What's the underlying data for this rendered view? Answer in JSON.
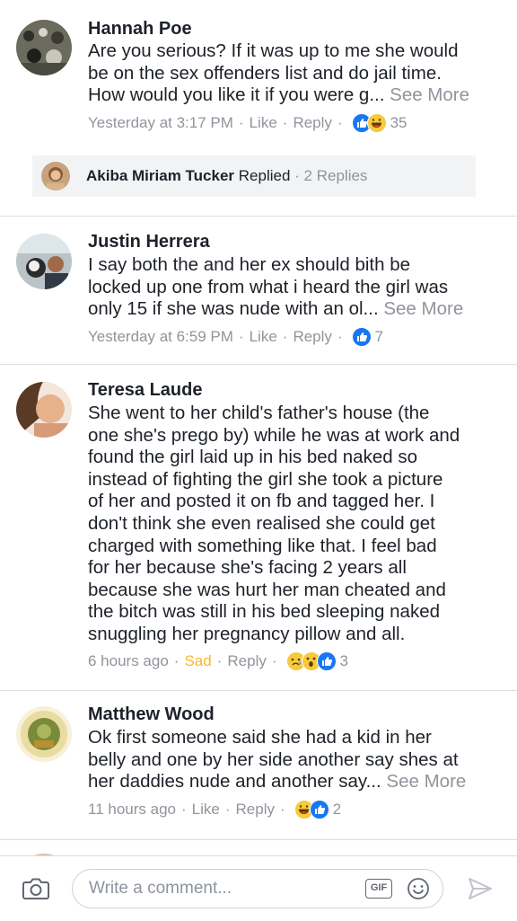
{
  "comments": [
    {
      "name": "Hannah Poe",
      "lines": [
        "Are you serious? If it was up to me she would",
        "be on the sex offenders list and do jail time.",
        "How would you like it if you were g..."
      ],
      "see_more": "See More",
      "time": "Yesterday at 3:17 PM",
      "action1": "Like",
      "reply": "Reply",
      "reactions": [
        "like-icon",
        "haha-icon"
      ],
      "count": "35"
    },
    {
      "name": "Justin Herrera",
      "lines": [
        "I say both the and her ex should bith be",
        "locked up one from what i heard the girl was",
        "only 15 if she was nude with an ol..."
      ],
      "see_more": "See More",
      "time": "Yesterday at 6:59 PM",
      "action1": "Like",
      "reply": "Reply",
      "reactions": [
        "like-icon"
      ],
      "count": "7"
    },
    {
      "name": "Teresa Laude",
      "lines": [
        "She went to her child's father's house  (the",
        "one she's prego by) while he was at work and",
        "found the girl laid up in his bed naked so",
        "instead of fighting the girl she took a picture",
        "of her and posted it on fb and tagged her. I",
        "don't think she even realised she could get",
        "charged with something like that. I feel bad",
        "for her because she's facing 2 years all",
        "because she was hurt her man cheated and",
        "the bitch was still in his bed sleeping naked",
        "snuggling her pregnancy pillow and all."
      ],
      "see_more": "",
      "time": "6 hours ago",
      "action1": "Sad",
      "reply": "Reply",
      "reactions": [
        "sad-icon",
        "wow-icon",
        "like-icon"
      ],
      "count": "3"
    },
    {
      "name": "Matthew Wood",
      "lines": [
        "Ok first someone said she had a kid in her",
        "belly and one by her side another say shes at",
        "her daddies nude and another say..."
      ],
      "see_more": "See More",
      "time": "11 hours ago",
      "action1": "Like",
      "reply": "Reply",
      "reactions": [
        "haha-icon",
        "like-icon"
      ],
      "count": "2"
    }
  ],
  "replies": {
    "name": "Akiba Miriam Tucker",
    "label": "Replied",
    "count": "2 Replies"
  },
  "composer": {
    "placeholder": "Write a comment...",
    "gif_label": "GIF"
  },
  "colors": {
    "link_blue": "#1877f2",
    "meta_gray": "#90949c",
    "sad_yellow": "#f7b928"
  }
}
